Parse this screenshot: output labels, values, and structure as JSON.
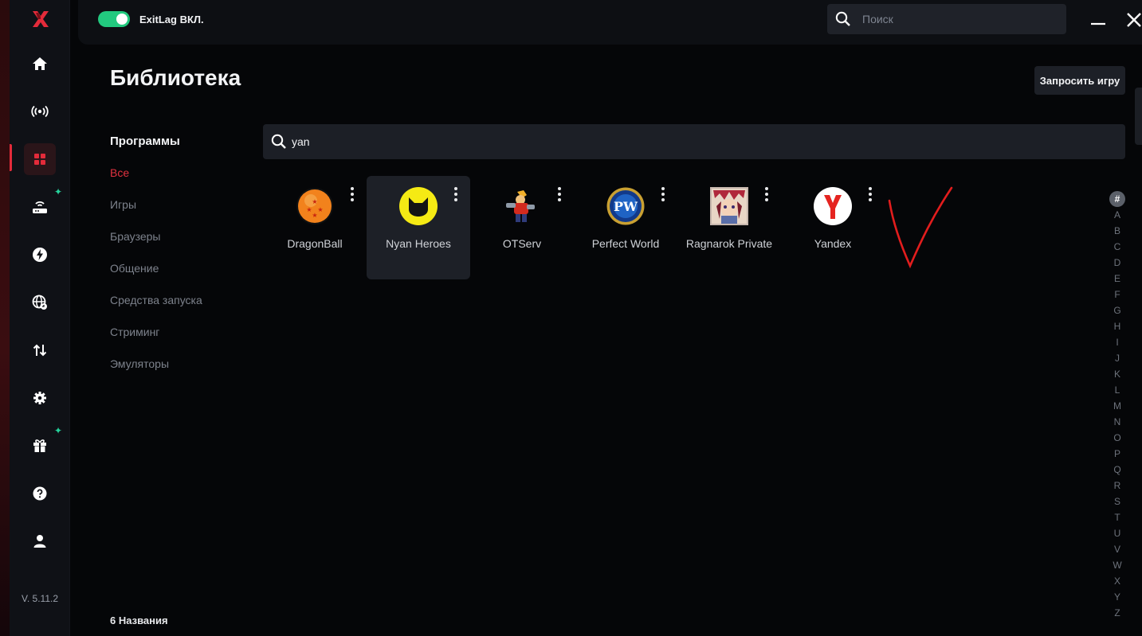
{
  "app": {
    "status_label": "ExitLag ВКЛ.",
    "version": "V. 5.11.2",
    "accent": "#e1323f",
    "toggle_color": "#22c97f"
  },
  "topbar": {
    "search_placeholder": "Поиск"
  },
  "library": {
    "title": "Библиотека",
    "request_button": "Запросить игру",
    "search_value": "yan",
    "count_label": "6 Названия"
  },
  "categories": {
    "title": "Программы",
    "items": [
      "Все",
      "Игры",
      "Браузеры",
      "Общение",
      "Средства запуска",
      "Стриминг",
      "Эмуляторы"
    ]
  },
  "games": [
    {
      "name": "DragonBall",
      "icon": "dragonball-icon"
    },
    {
      "name": "Nyan Heroes",
      "icon": "nyan-heroes-icon"
    },
    {
      "name": "OTServ",
      "icon": "otserv-icon"
    },
    {
      "name": "Perfect World",
      "icon": "perfect-world-icon",
      "badge": "PW"
    },
    {
      "name": "Ragnarok Private",
      "icon": "ragnarok-icon"
    },
    {
      "name": "Yandex",
      "icon": "yandex-icon"
    }
  ],
  "alphabet": {
    "hash": "#",
    "letters": [
      "A",
      "B",
      "C",
      "D",
      "E",
      "F",
      "G",
      "H",
      "I",
      "J",
      "K",
      "L",
      "M",
      "N",
      "O",
      "P",
      "Q",
      "R",
      "S",
      "T",
      "U",
      "V",
      "W",
      "X",
      "Y",
      "Z"
    ]
  }
}
